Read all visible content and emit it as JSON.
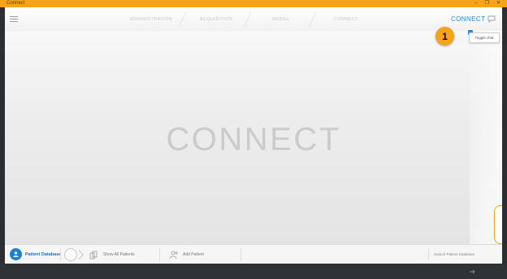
{
  "window": {
    "title": "Connect",
    "controls": [
      "–",
      "❐",
      "✕"
    ]
  },
  "nav": {
    "steps": [
      "ADMINISTRATION",
      "ACQUISITION",
      "MODEL",
      "CONNECT"
    ],
    "active_label": "CONNECT"
  },
  "main": {
    "title": "CONNECT"
  },
  "tooltip": {
    "text": "Toggle chat"
  },
  "callout": {
    "number": "1"
  },
  "bottom": {
    "patient_db_label": "Patient Database",
    "show_all_label": "Show All Patients",
    "add_patient_label": "Add Patient",
    "search_placeholder": "Search Patient Database"
  },
  "colors": {
    "accent": "#2b8ad6",
    "titlebar": "#f5a31a",
    "callout": "#f5a31a",
    "footer": "#2f3337"
  },
  "icons": [
    "menu-icon",
    "chat-icon",
    "patient-database-icon",
    "settings-ring-icon",
    "chevron-right-icon",
    "show-all-patients-icon",
    "add-patient-icon",
    "status-icon"
  ]
}
